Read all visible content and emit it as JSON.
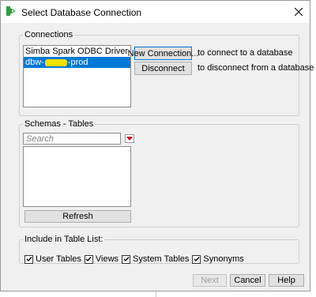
{
  "window": {
    "title": "Select Database Connection"
  },
  "connections": {
    "legend": "Connections",
    "items": [
      {
        "label": "Simba Spark ODBC Driver"
      },
      {
        "label_prefix": "dbw-",
        "label_suffix": "-prod"
      }
    ],
    "new_connection_label": "New Connection...",
    "new_connection_hint": "to connect to a database",
    "disconnect_label": "Disconnect",
    "disconnect_hint": "to disconnect from a database"
  },
  "schemas": {
    "legend": "Schemas - Tables",
    "search_placeholder": "Search",
    "refresh_label": "Refresh"
  },
  "include": {
    "legend": "Include in Table List:",
    "options": [
      {
        "label": "User Tables",
        "checked": true
      },
      {
        "label": "Views",
        "checked": true
      },
      {
        "label": "System Tables",
        "checked": true
      },
      {
        "label": "Synonyms",
        "checked": true
      }
    ]
  },
  "footer": {
    "next_label": "Next",
    "cancel_label": "Cancel",
    "help_label": "Help"
  },
  "colors": {
    "selection": "#0078d7",
    "redaction": "#f2e000",
    "dropdown_accent": "#d0021b"
  }
}
